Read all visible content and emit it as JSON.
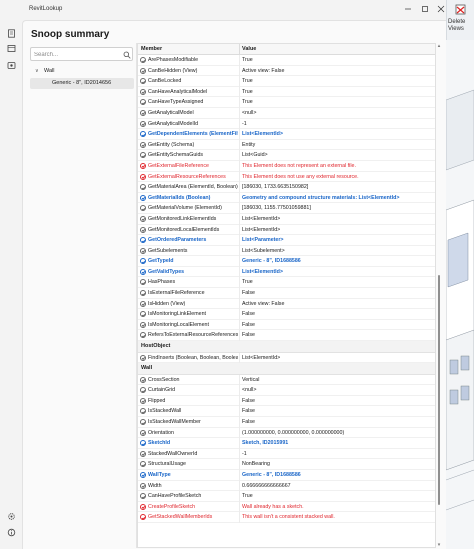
{
  "app": {
    "title": "RevitLookup"
  },
  "page": {
    "title": "Snoop summary"
  },
  "search": {
    "placeholder": "Search..."
  },
  "tree": {
    "items": [
      {
        "label": "Wall",
        "level": 0
      },
      {
        "label": "Generic - 8\", ID2014656",
        "level": 1
      }
    ]
  },
  "grid": {
    "col_member": "Member",
    "col_value": "Value",
    "rows": [
      {
        "m": "ArePhasesModifiable",
        "v": "True",
        "t": ""
      },
      {
        "m": "CanBeHidden (View)",
        "v": "Active view: False",
        "t": ""
      },
      {
        "m": "CanBeLocked",
        "v": "True",
        "t": ""
      },
      {
        "m": "CanHaveAnalyticalModel",
        "v": "True",
        "t": ""
      },
      {
        "m": "CanHaveTypeAssigned",
        "v": "True",
        "t": ""
      },
      {
        "m": "GetAnalyticalModel",
        "v": "<null>",
        "t": ""
      },
      {
        "m": "GetAnalyticalModelId",
        "v": "-1",
        "t": ""
      },
      {
        "m": "GetDependentElements (ElementFilter)",
        "v": "List<ElementId>",
        "t": "link"
      },
      {
        "m": "GetEntity (Schema)",
        "v": "Entity",
        "t": ""
      },
      {
        "m": "GetEntitySchemaGuids",
        "v": "List<Guid>",
        "t": ""
      },
      {
        "m": "GetExternalFileReference",
        "v": "This Element does not represent an external file.",
        "t": "err"
      },
      {
        "m": "GetExternalResourceReferences",
        "v": "This Element does not use any external resource.",
        "t": "err"
      },
      {
        "m": "GetMaterialArea (ElementId, Boolean)",
        "v": "[186030, 1733.6635150982]",
        "t": ""
      },
      {
        "m": "GetMaterialIds (Boolean)",
        "v": "Geometry and compound structure materials: List<ElementId>",
        "t": "link"
      },
      {
        "m": "GetMaterialVolume (ElementId)",
        "v": "[186030, 1155.77501059881]",
        "t": ""
      },
      {
        "m": "GetMonitoredLinkElementIds",
        "v": "List<ElementId>",
        "t": ""
      },
      {
        "m": "GetMonitoredLocalElementIds",
        "v": "List<ElementId>",
        "t": ""
      },
      {
        "m": "GetOrderedParameters",
        "v": "List<Parameter>",
        "t": "link"
      },
      {
        "m": "GetSubelements",
        "v": "List<Subelement>",
        "t": ""
      },
      {
        "m": "GetTypeId",
        "v": "Generic - 8\", ID1688586",
        "t": "link"
      },
      {
        "m": "GetValidTypes",
        "v": "List<ElementId>",
        "t": "link"
      },
      {
        "m": "HasPhases",
        "v": "True",
        "t": ""
      },
      {
        "m": "IsExternalFileReference",
        "v": "False",
        "t": ""
      },
      {
        "m": "IsHidden (View)",
        "v": "Active view: False",
        "t": ""
      },
      {
        "m": "IsMonitoringLinkElement",
        "v": "False",
        "t": ""
      },
      {
        "m": "IsMonitoringLocalElement",
        "v": "False",
        "t": ""
      },
      {
        "m": "RefersToExternalResourceReferences",
        "v": "False",
        "t": ""
      },
      {
        "group": "HostObject"
      },
      {
        "m": "FindInserts (Boolean, Boolean, Boolean, Boolean)",
        "v": "List<ElementId>",
        "t": ""
      },
      {
        "group": "Wall"
      },
      {
        "m": "CrossSection",
        "v": "Vertical",
        "t": ""
      },
      {
        "m": "CurtainGrid",
        "v": "<null>",
        "t": ""
      },
      {
        "m": "Flipped",
        "v": "False",
        "t": ""
      },
      {
        "m": "IsStackedWall",
        "v": "False",
        "t": ""
      },
      {
        "m": "IsStackedWallMember",
        "v": "False",
        "t": ""
      },
      {
        "m": "Orientation",
        "v": "(1.000000000, 0.000000000, 0.000000000)",
        "t": ""
      },
      {
        "m": "SketchId",
        "v": "Sketch, ID2015991",
        "t": "link"
      },
      {
        "m": "StackedWallOwnerId",
        "v": "-1",
        "t": ""
      },
      {
        "m": "StructuralUsage",
        "v": "NonBearing",
        "t": ""
      },
      {
        "m": "WallType",
        "v": "Generic - 8\", ID1688586",
        "t": "link"
      },
      {
        "m": "Width",
        "v": "0.666666666666667",
        "t": ""
      },
      {
        "m": "CanHaveProfileSketch",
        "v": "True",
        "t": ""
      },
      {
        "m": "CreateProfileSketch",
        "v": "Wall already has a sketch.",
        "t": "err"
      },
      {
        "m": "GetStackedWallMemberIds",
        "v": "This wall isn't a consistent stacked wall.",
        "t": "err"
      }
    ]
  },
  "ribbon": {
    "delete_views_label": "Delete Views"
  },
  "icons": {
    "rail": [
      "document-icon",
      "layers-icon",
      "snoop-icon",
      "settings-icon",
      "info-icon"
    ]
  },
  "colors": {
    "link": "#1a66c8",
    "error": "#e0262d"
  }
}
